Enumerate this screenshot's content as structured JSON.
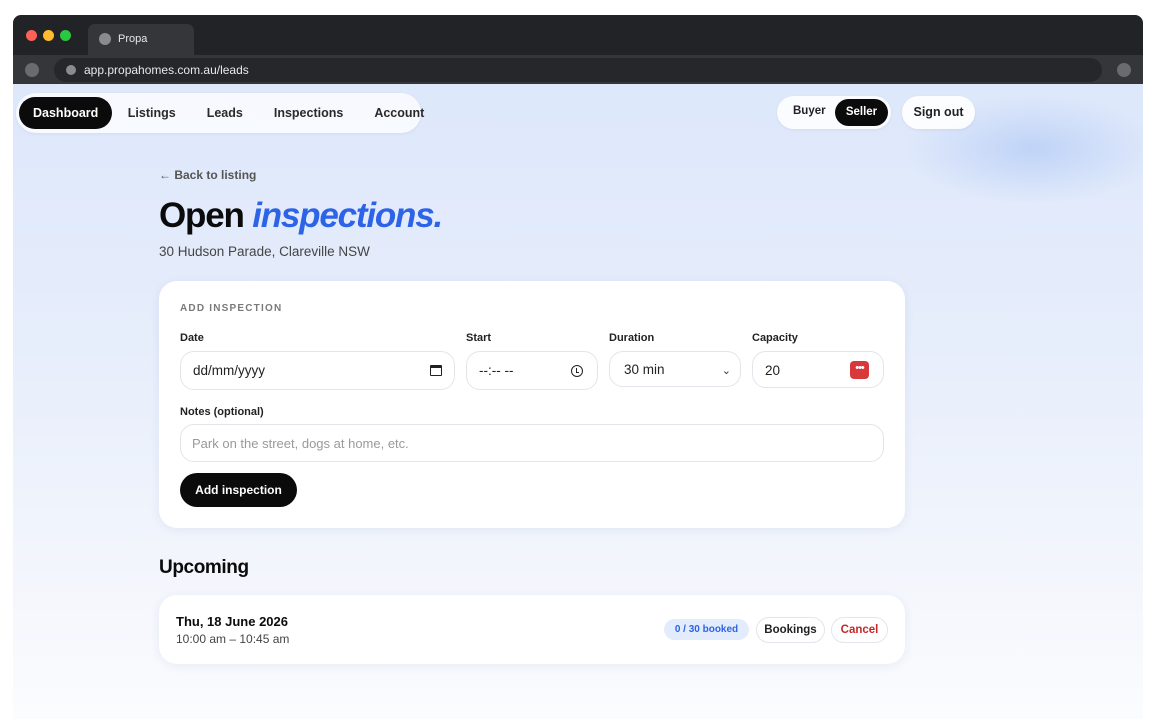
{
  "browser": {
    "tab_title": "Propa",
    "url": "app.propahomes.com.au/leads"
  },
  "nav": {
    "items": [
      {
        "label": "Dashboard",
        "active": true
      },
      {
        "label": "Listings",
        "active": false
      },
      {
        "label": "Leads",
        "active": false
      },
      {
        "label": "Inspections",
        "active": false
      },
      {
        "label": "Account",
        "active": false
      }
    ],
    "mode": {
      "buyer": "Buyer",
      "seller": "Seller",
      "selected": "Seller"
    },
    "sign_out": "Sign out"
  },
  "page": {
    "back_link": "← Back to listing",
    "title_plain": "Open ",
    "title_accent": "inspections.",
    "address": "30 Hudson Parade, Clareville NSW"
  },
  "form": {
    "section_label": "ADD INSPECTION",
    "date": {
      "label": "Date",
      "placeholder": "dd/mm/yyyy"
    },
    "start": {
      "label": "Start",
      "placeholder": "--:-- --"
    },
    "duration": {
      "label": "Duration",
      "value": "30 min"
    },
    "capacity": {
      "label": "Capacity",
      "value": "20"
    },
    "notes": {
      "label": "Notes (optional)",
      "placeholder": "Park on the street, dogs at home, etc."
    },
    "submit": "Add inspection"
  },
  "upcoming": {
    "title": "Upcoming",
    "items": [
      {
        "date": "Thu, 18 June 2026",
        "time": "10:00 am – 10:45 am",
        "booked_badge": "0 / 30 booked",
        "bookings_label": "Bookings",
        "cancel_label": "Cancel"
      }
    ]
  },
  "colors": {
    "accent": "#2d63e6",
    "primary_button": "#0b0b0b",
    "danger": "#c62828",
    "badge_bg": "#e3ecfc"
  }
}
